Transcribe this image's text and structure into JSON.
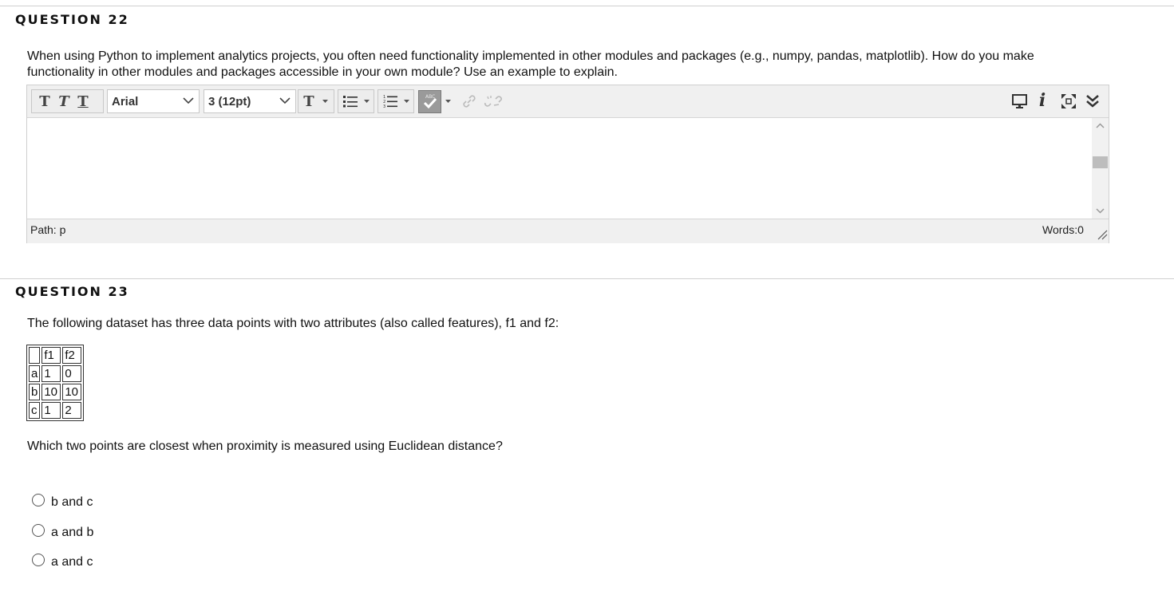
{
  "q22": {
    "title": "QUESTION 22",
    "text": "When using Python to implement analytics projects, you often need functionality implemented in other modules and packages (e.g., numpy, pandas, matplotlib). How do you make functionality in other modules and packages accessible in your own module? Use an example to explain.",
    "editor": {
      "font_family_value": "Arial",
      "font_size_value": "3 (12pt)",
      "path_label": "Path: p",
      "word_count": "Words:0",
      "content": ""
    }
  },
  "q23": {
    "title": "QUESTION 23",
    "intro": "The following dataset has three data points with two attributes (also called features), f1 and f2:",
    "table": {
      "headers": [
        "",
        "f1",
        "f2"
      ],
      "rows": [
        [
          "a",
          "1",
          "0"
        ],
        [
          "b",
          "10",
          "10"
        ],
        [
          "c",
          "1",
          "2"
        ]
      ]
    },
    "prompt": "Which two points are closest when proximity is measured using Euclidean distance?",
    "options": [
      "b and c",
      "a and b",
      "a and c"
    ]
  },
  "icons": {
    "toolbar_left": [
      "bold-text-icon",
      "italic-text-icon",
      "underline-text-icon",
      "text-color-icon",
      "bullet-list-icon",
      "numbered-list-icon",
      "spellcheck-icon",
      "link-icon",
      "unlink-icon"
    ],
    "toolbar_right": [
      "preview-icon",
      "info-icon",
      "fullscreen-icon",
      "expand-toolbar-icon"
    ]
  },
  "colors": {
    "toolbar_bg": "#f0f0f0",
    "spellcheck_bg": "#9a9a9a",
    "divider": "#cfcfcf"
  }
}
